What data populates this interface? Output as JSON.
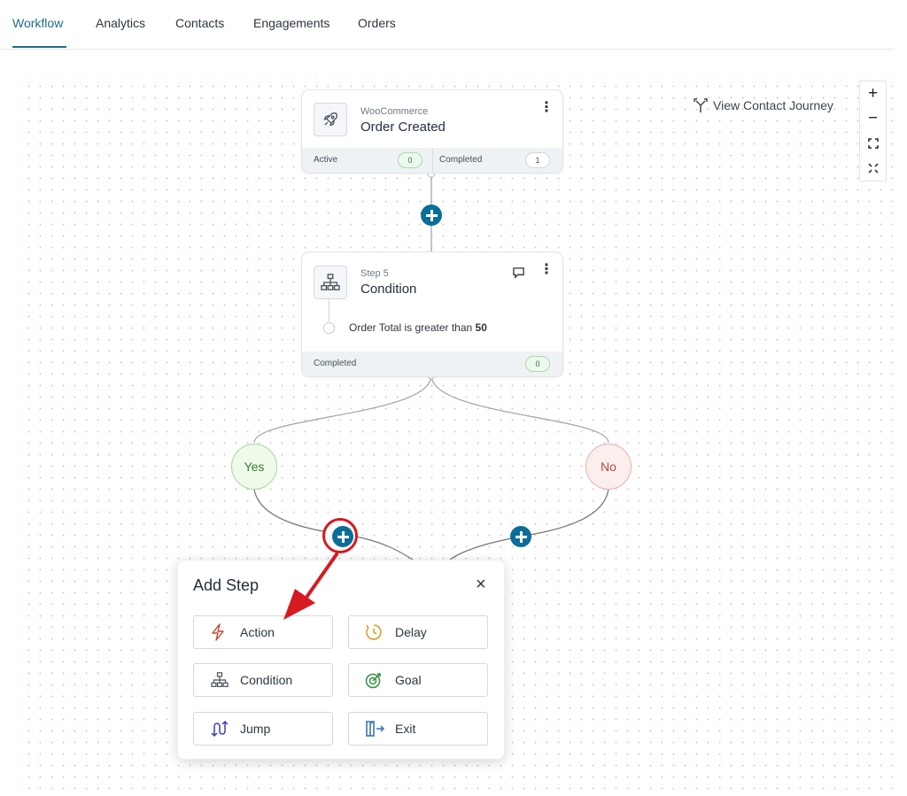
{
  "tabs": [
    {
      "label": "Workflow",
      "active": true
    },
    {
      "label": "Analytics"
    },
    {
      "label": "Contacts"
    },
    {
      "label": "Engagements"
    },
    {
      "label": "Orders"
    }
  ],
  "trigger_node": {
    "icon": "rocket-icon",
    "subtitle": "WooCommerce",
    "title": "Order Created",
    "active_label": "Active",
    "active_count": "0",
    "completed_label": "Completed",
    "completed_count": "1"
  },
  "condition_node": {
    "icon": "sitemap-icon",
    "subtitle": "Step 5",
    "title": "Condition",
    "rule_text": "Order Total is greater than",
    "rule_value": "50",
    "completed_label": "Completed",
    "completed_count": "0"
  },
  "branches": {
    "yes": "Yes",
    "no": "No"
  },
  "view_journey": "View Contact Journey",
  "zoom_controls": {
    "zoom_in": "+",
    "zoom_out": "−"
  },
  "add_step": {
    "title": "Add Step",
    "close": "×",
    "options": [
      {
        "label": "Action",
        "icon": "lightning-icon"
      },
      {
        "label": "Delay",
        "icon": "clock-icon"
      },
      {
        "label": "Condition",
        "icon": "sitemap-icon"
      },
      {
        "label": "Goal",
        "icon": "target-icon"
      },
      {
        "label": "Jump",
        "icon": "jump-icon"
      },
      {
        "label": "Exit",
        "icon": "exit-icon"
      }
    ]
  },
  "colors": {
    "accent": "#0b6e99",
    "annotation": "#d71920",
    "yes": "#397a2b",
    "no": "#b34747"
  }
}
